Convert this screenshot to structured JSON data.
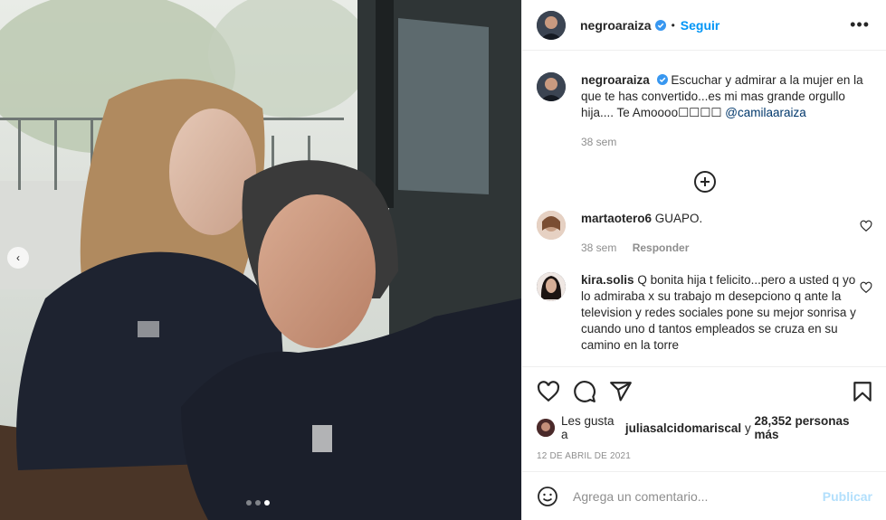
{
  "post": {
    "username": "negroaraiza",
    "follow_label": "Seguir",
    "separator": "•",
    "more_label": "•••",
    "prev_label": "‹"
  },
  "caption": {
    "username": "negroaraiza",
    "text": "Escuchar y admirar a la mujer en la que te has convertido...es mi mas grande orgullo hija.... Te Amoooo☐☐☐☐",
    "mention": "@camilaaraiza",
    "time": "38 sem"
  },
  "comments": [
    {
      "username": "martaotero6",
      "text": "GUAPO.",
      "time": "38 sem",
      "reply_label": "Responder"
    },
    {
      "username": "kira.solis",
      "text": "Q bonita hija t felicito...pero a usted q yo lo admiraba x su trabajo m desepciono q ante la television y redes sociales pone su mejor sonrisa y cuando uno d tantos empleados se cruza en su camino en la torre",
      "time": "",
      "reply_label": ""
    }
  ],
  "likes": {
    "prefix": "Les gusta a",
    "liker": "juliasalcidomariscal",
    "middle": "y",
    "count": "28,352 personas más"
  },
  "date": "12 DE ABRIL DE 2021",
  "add_comment": {
    "placeholder": "Agrega un comentario...",
    "publish_label": "Publicar"
  },
  "carousel": {
    "total": 3,
    "active_index": 2
  },
  "icons": {
    "like": "heart-icon",
    "comment": "comment-icon",
    "share": "share-icon",
    "save": "bookmark-icon",
    "emoji": "emoji-icon",
    "load_more": "plus-circle-icon",
    "verified": "verified-badge-icon"
  },
  "colors": {
    "accent": "#0095f6",
    "publish_disabled": "#b2dffc",
    "verified": "#3897f0",
    "muted": "#8e8e8e",
    "text": "#262626"
  }
}
